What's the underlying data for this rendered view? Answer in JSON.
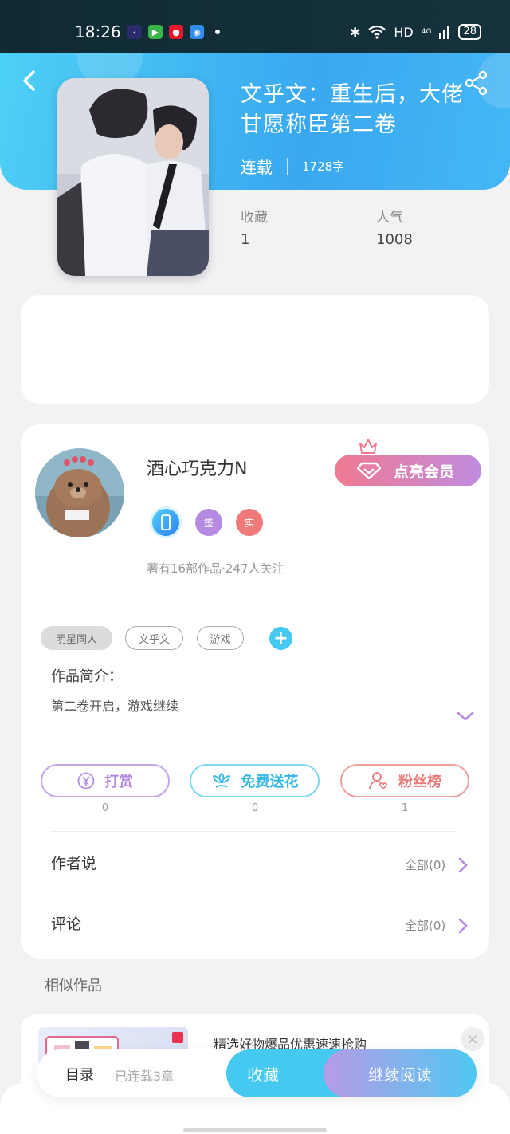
{
  "status_bar": {
    "time": "18:26",
    "network": "HD",
    "signal": "4G",
    "battery": "28",
    "icons": [
      "kuaishou-icon",
      "video-icon",
      "weibo-icon",
      "browser-icon"
    ]
  },
  "book": {
    "title": "文乎文：重生后，大佬甘愿称臣第二卷",
    "status": "连载",
    "word_count": "1728字",
    "favorites_label": "收藏",
    "favorites_value": "1",
    "popularity_label": "人气",
    "popularity_value": "1008"
  },
  "author": {
    "name": "酒心巧克力N",
    "badges": [
      "",
      "签",
      "实"
    ],
    "stats": "著有16部作品·247人关注",
    "vip_button": "点亮会员"
  },
  "tags": [
    "明星同人",
    "文乎文",
    "游戏"
  ],
  "intro": {
    "label": "作品简介：",
    "text": "第二卷开启，游戏继续"
  },
  "actions": [
    {
      "label": "打赏",
      "count": "0"
    },
    {
      "label": "免费送花",
      "count": "0"
    },
    {
      "label": "粉丝榜",
      "count": "1"
    }
  ],
  "author_says": {
    "label": "作者说",
    "all": "全部(0)"
  },
  "comments": {
    "label": "评论",
    "all": "全部(0)"
  },
  "similar": {
    "title": "相似作品",
    "ad_title": "精选好物爆品优惠速速抢购"
  },
  "bottom": {
    "catalog": "目录",
    "chapters": "已连载3章",
    "collect": "收藏",
    "continue": "继续阅读"
  },
  "colors": {
    "accent": "#45c9f0",
    "vip_start": "#f07a90",
    "vip_end": "#c08be0",
    "tip": "#b48be0",
    "flower": "#45c9f0",
    "fans": "#f07a7a"
  }
}
